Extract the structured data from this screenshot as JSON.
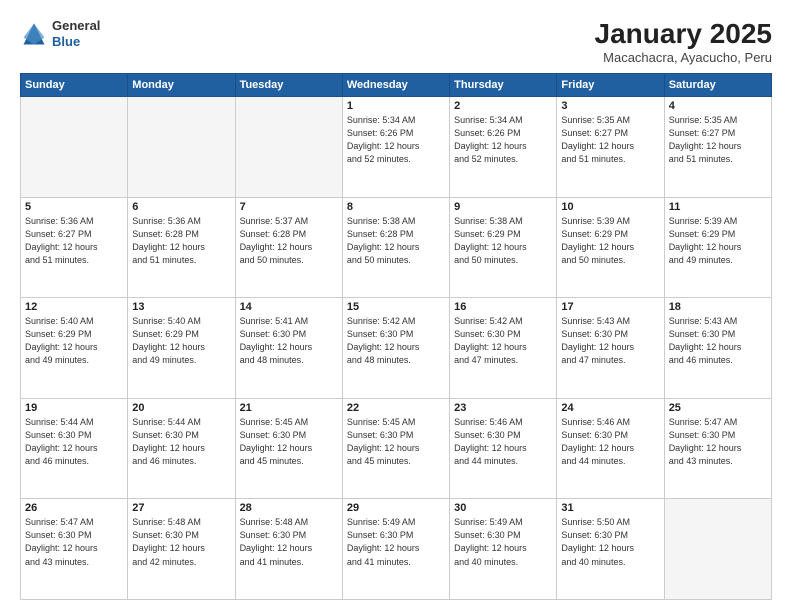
{
  "header": {
    "logo": {
      "general": "General",
      "blue": "Blue"
    },
    "title": "January 2025",
    "subtitle": "Macachacra, Ayacucho, Peru"
  },
  "weekdays": [
    "Sunday",
    "Monday",
    "Tuesday",
    "Wednesday",
    "Thursday",
    "Friday",
    "Saturday"
  ],
  "weeks": [
    [
      {
        "day": "",
        "info": ""
      },
      {
        "day": "",
        "info": ""
      },
      {
        "day": "",
        "info": ""
      },
      {
        "day": "1",
        "info": "Sunrise: 5:34 AM\nSunset: 6:26 PM\nDaylight: 12 hours\nand 52 minutes."
      },
      {
        "day": "2",
        "info": "Sunrise: 5:34 AM\nSunset: 6:26 PM\nDaylight: 12 hours\nand 52 minutes."
      },
      {
        "day": "3",
        "info": "Sunrise: 5:35 AM\nSunset: 6:27 PM\nDaylight: 12 hours\nand 51 minutes."
      },
      {
        "day": "4",
        "info": "Sunrise: 5:35 AM\nSunset: 6:27 PM\nDaylight: 12 hours\nand 51 minutes."
      }
    ],
    [
      {
        "day": "5",
        "info": "Sunrise: 5:36 AM\nSunset: 6:27 PM\nDaylight: 12 hours\nand 51 minutes."
      },
      {
        "day": "6",
        "info": "Sunrise: 5:36 AM\nSunset: 6:28 PM\nDaylight: 12 hours\nand 51 minutes."
      },
      {
        "day": "7",
        "info": "Sunrise: 5:37 AM\nSunset: 6:28 PM\nDaylight: 12 hours\nand 50 minutes."
      },
      {
        "day": "8",
        "info": "Sunrise: 5:38 AM\nSunset: 6:28 PM\nDaylight: 12 hours\nand 50 minutes."
      },
      {
        "day": "9",
        "info": "Sunrise: 5:38 AM\nSunset: 6:29 PM\nDaylight: 12 hours\nand 50 minutes."
      },
      {
        "day": "10",
        "info": "Sunrise: 5:39 AM\nSunset: 6:29 PM\nDaylight: 12 hours\nand 50 minutes."
      },
      {
        "day": "11",
        "info": "Sunrise: 5:39 AM\nSunset: 6:29 PM\nDaylight: 12 hours\nand 49 minutes."
      }
    ],
    [
      {
        "day": "12",
        "info": "Sunrise: 5:40 AM\nSunset: 6:29 PM\nDaylight: 12 hours\nand 49 minutes."
      },
      {
        "day": "13",
        "info": "Sunrise: 5:40 AM\nSunset: 6:29 PM\nDaylight: 12 hours\nand 49 minutes."
      },
      {
        "day": "14",
        "info": "Sunrise: 5:41 AM\nSunset: 6:30 PM\nDaylight: 12 hours\nand 48 minutes."
      },
      {
        "day": "15",
        "info": "Sunrise: 5:42 AM\nSunset: 6:30 PM\nDaylight: 12 hours\nand 48 minutes."
      },
      {
        "day": "16",
        "info": "Sunrise: 5:42 AM\nSunset: 6:30 PM\nDaylight: 12 hours\nand 47 minutes."
      },
      {
        "day": "17",
        "info": "Sunrise: 5:43 AM\nSunset: 6:30 PM\nDaylight: 12 hours\nand 47 minutes."
      },
      {
        "day": "18",
        "info": "Sunrise: 5:43 AM\nSunset: 6:30 PM\nDaylight: 12 hours\nand 46 minutes."
      }
    ],
    [
      {
        "day": "19",
        "info": "Sunrise: 5:44 AM\nSunset: 6:30 PM\nDaylight: 12 hours\nand 46 minutes."
      },
      {
        "day": "20",
        "info": "Sunrise: 5:44 AM\nSunset: 6:30 PM\nDaylight: 12 hours\nand 46 minutes."
      },
      {
        "day": "21",
        "info": "Sunrise: 5:45 AM\nSunset: 6:30 PM\nDaylight: 12 hours\nand 45 minutes."
      },
      {
        "day": "22",
        "info": "Sunrise: 5:45 AM\nSunset: 6:30 PM\nDaylight: 12 hours\nand 45 minutes."
      },
      {
        "day": "23",
        "info": "Sunrise: 5:46 AM\nSunset: 6:30 PM\nDaylight: 12 hours\nand 44 minutes."
      },
      {
        "day": "24",
        "info": "Sunrise: 5:46 AM\nSunset: 6:30 PM\nDaylight: 12 hours\nand 44 minutes."
      },
      {
        "day": "25",
        "info": "Sunrise: 5:47 AM\nSunset: 6:30 PM\nDaylight: 12 hours\nand 43 minutes."
      }
    ],
    [
      {
        "day": "26",
        "info": "Sunrise: 5:47 AM\nSunset: 6:30 PM\nDaylight: 12 hours\nand 43 minutes."
      },
      {
        "day": "27",
        "info": "Sunrise: 5:48 AM\nSunset: 6:30 PM\nDaylight: 12 hours\nand 42 minutes."
      },
      {
        "day": "28",
        "info": "Sunrise: 5:48 AM\nSunset: 6:30 PM\nDaylight: 12 hours\nand 41 minutes."
      },
      {
        "day": "29",
        "info": "Sunrise: 5:49 AM\nSunset: 6:30 PM\nDaylight: 12 hours\nand 41 minutes."
      },
      {
        "day": "30",
        "info": "Sunrise: 5:49 AM\nSunset: 6:30 PM\nDaylight: 12 hours\nand 40 minutes."
      },
      {
        "day": "31",
        "info": "Sunrise: 5:50 AM\nSunset: 6:30 PM\nDaylight: 12 hours\nand 40 minutes."
      },
      {
        "day": "",
        "info": ""
      }
    ]
  ]
}
